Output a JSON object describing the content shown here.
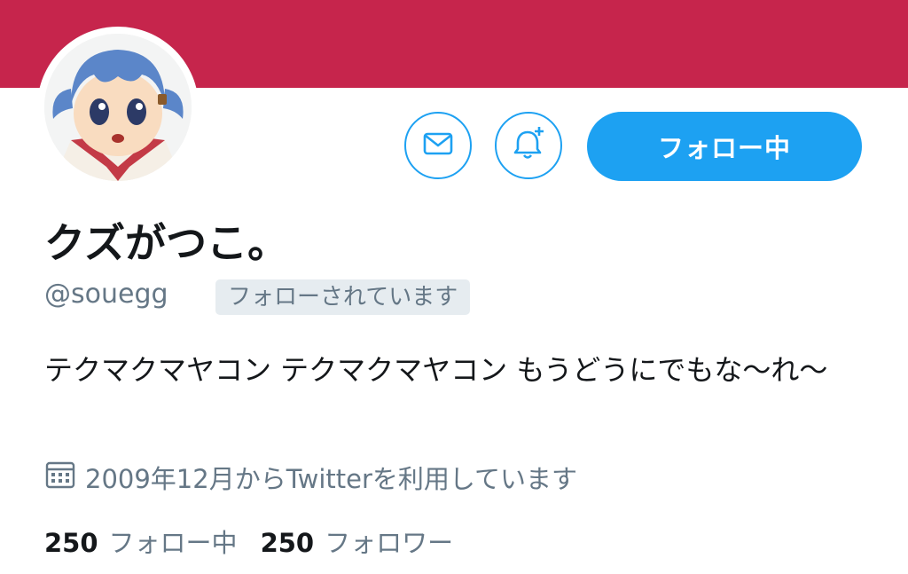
{
  "profile": {
    "display_name": "クズがつこ。",
    "handle": "@souegg",
    "follows_you": "フォローされています",
    "bio": "テクマクマヤコン テクマクマヤコン もうどうにでもな〜れ〜",
    "joined": "2009年12月からTwitterを利用しています"
  },
  "actions": {
    "message_icon": "envelope-icon",
    "notify_icon": "bell-plus-icon",
    "follow_label": "フォロー中"
  },
  "stats": {
    "following_count": "250",
    "following_label": "フォロー中",
    "followers_count": "250",
    "followers_label": "フォロワー"
  },
  "colors": {
    "banner": "#c6254c",
    "accent": "#1da1f2",
    "muted": "#657786",
    "badge_bg": "#e6ecf0"
  }
}
